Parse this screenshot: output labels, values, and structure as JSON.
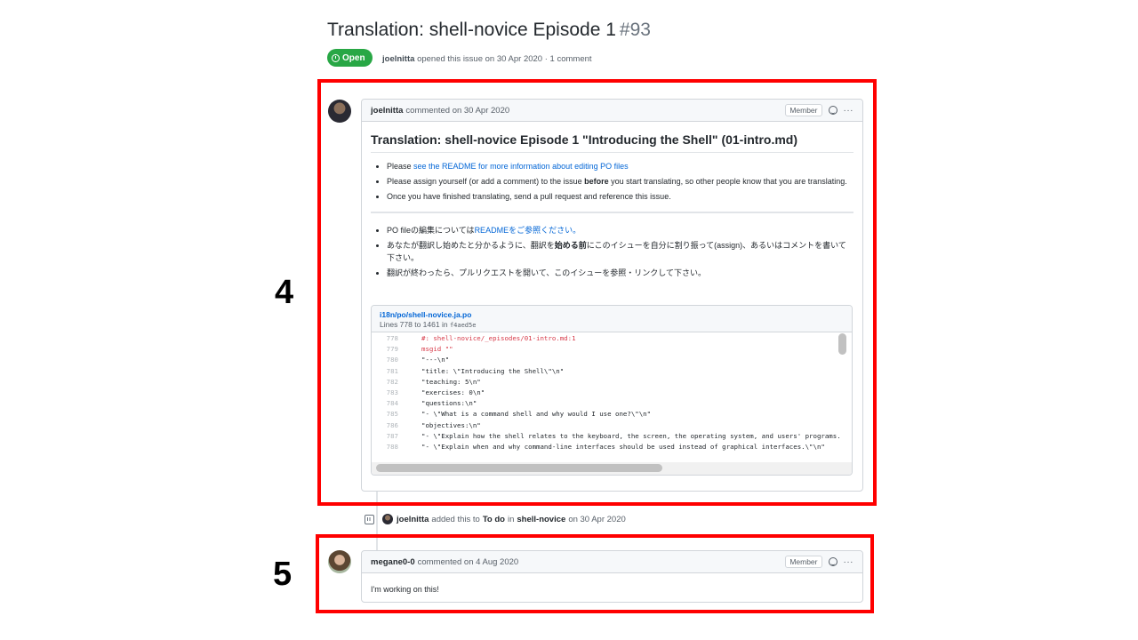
{
  "issue": {
    "title": "Translation: shell-novice Episode 1",
    "number": "#93",
    "state": "Open",
    "author": "joelnitta",
    "opened_text": "opened this issue on 30 Apr 2020 · 1 comment"
  },
  "markers": {
    "first": "4",
    "second": "5"
  },
  "comment1": {
    "author": "joelnitta",
    "action": "commented on 30 Apr 2020",
    "badge": "Member",
    "more": "···",
    "title": "Translation: shell-novice Episode 1 \"Introducing the Shell\" (01-intro.md)",
    "en": {
      "b1_prefix": "Please ",
      "b1_link": "see the README for more information about editing PO files",
      "b2_prefix": "Please assign yourself (or add a comment) to the issue ",
      "b2_bold": "before",
      "b2_suffix": " you start translating, so other people know that you are translating.",
      "b3": "Once you have finished translating, send a pull request and reference this issue."
    },
    "ja": {
      "b1_prefix": "PO fileの編集については",
      "b1_link": "READMEをご参照ください。",
      "b2_prefix": "あなたが翻訳し始めたと分かるように、翻訳を",
      "b2_bold": "始める前",
      "b2_suffix": "にこのイシューを自分に割り振って(assign)、あるいはコメントを書いて下さい。",
      "b3": "翻訳が終わったら、プルリクエストを開いて、このイシューを参照・リンクして下さい。"
    },
    "code": {
      "file": "i18n/po/shell-novice.ja.po",
      "lines_label": "Lines 778 to 1461 in",
      "sha": "f4aed5e",
      "rows": [
        {
          "n": "778",
          "t": "#: shell-novice/_episodes/01-intro.md:1",
          "k": "comment"
        },
        {
          "n": "779",
          "t": "msgid \"\"",
          "k": "keyword"
        },
        {
          "n": "780",
          "t": "\"---\\n\"",
          "k": ""
        },
        {
          "n": "781",
          "t": "\"title: \\\"Introducing the Shell\\\"\\n\"",
          "k": ""
        },
        {
          "n": "782",
          "t": "\"teaching: 5\\n\"",
          "k": ""
        },
        {
          "n": "783",
          "t": "\"exercises: 0\\n\"",
          "k": ""
        },
        {
          "n": "784",
          "t": "\"questions:\\n\"",
          "k": ""
        },
        {
          "n": "785",
          "t": "\"- \\\"What is a command shell and why would I use one?\\\"\\n\"",
          "k": ""
        },
        {
          "n": "786",
          "t": "\"objectives:\\n\"",
          "k": ""
        },
        {
          "n": "787",
          "t": "\"- \\\"Explain how the shell relates to the keyboard, the screen, the operating system, and users' programs.",
          "k": ""
        },
        {
          "n": "788",
          "t": "\"- \\\"Explain when and why command-line interfaces should be used instead of graphical interfaces.\\\"\\n\"",
          "k": ""
        }
      ]
    }
  },
  "event": {
    "actor": "joelnitta",
    "text1": "added this to",
    "column": "To do",
    "text2": "in",
    "project": "shell-novice",
    "text3": "on 30 Apr 2020"
  },
  "comment2": {
    "author": "megane0-0",
    "action": "commented on 4 Aug 2020",
    "badge": "Member",
    "more": "···",
    "body": "I'm working on this!"
  }
}
